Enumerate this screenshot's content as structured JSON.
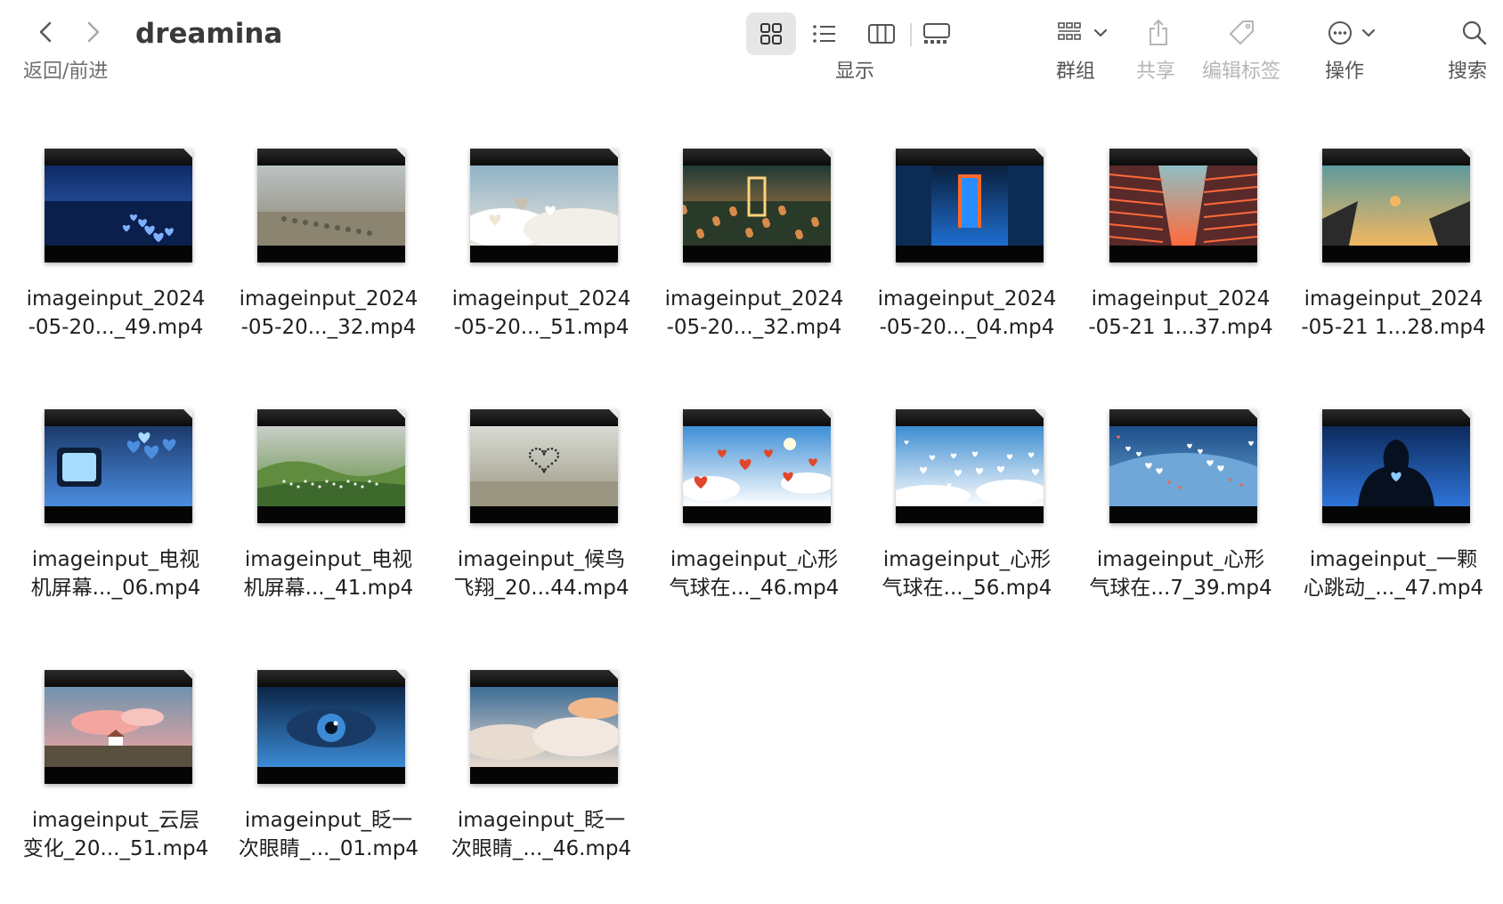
{
  "window": {
    "title": "dreamina"
  },
  "toolbar": {
    "nav_label": "返回/前进",
    "view_label": "显示",
    "group_label": "群组",
    "share_label": "共享",
    "tags_label": "编辑标签",
    "action_label": "操作",
    "search_label": "搜索"
  },
  "files": [
    {
      "line1": "imageinput_2024",
      "line2": "-05-20..._49.mp4",
      "scene": "blue-field-hearts",
      "colors": [
        "#0e2a66",
        "#3b6cc4",
        "#7fb0ff"
      ]
    },
    {
      "line1": "imageinput_2024",
      "line2": "-05-20..._32.mp4",
      "scene": "misty-meadow-path",
      "colors": [
        "#bcc3c4",
        "#8a8470",
        "#5e5a4a"
      ]
    },
    {
      "line1": "imageinput_2024",
      "line2": "-05-20..._51.mp4",
      "scene": "cloud-hearts",
      "colors": [
        "#8fb2c6",
        "#e9e5dc",
        "#c8c0ae"
      ]
    },
    {
      "line1": "imageinput_2024",
      "line2": "-05-20..._32.mp4",
      "scene": "glowing-door-flowers",
      "colors": [
        "#1e3a36",
        "#d98a4a",
        "#ffd27a"
      ]
    },
    {
      "line1": "imageinput_2024",
      "line2": "-05-20..._04.mp4",
      "scene": "city-portal",
      "colors": [
        "#0a1f3c",
        "#1f6ed0",
        "#ff6a2a"
      ]
    },
    {
      "line1": "imageinput_2024",
      "line2": "-05-21 1...37.mp4",
      "scene": "skyscraper-sky-lights",
      "colors": [
        "#8fbfc4",
        "#ff6a3a",
        "#5a2a2a"
      ]
    },
    {
      "line1": "imageinput_2024",
      "line2": "-05-21 1...28.mp4",
      "scene": "skyscraper-sky-sun",
      "colors": [
        "#5e9a9c",
        "#f2b860",
        "#2b2b2b"
      ]
    },
    {
      "line1": "imageinput_电视",
      "line2": "机屏幕..._06.mp4",
      "scene": "tv-heart-balloons",
      "colors": [
        "#1c3a6c",
        "#4c8de0",
        "#a8dcff"
      ]
    },
    {
      "line1": "imageinput_电视",
      "line2": "机屏幕..._41.mp4",
      "scene": "green-valley",
      "colors": [
        "#c9cfc9",
        "#5f8c3e",
        "#3d6a2c"
      ]
    },
    {
      "line1": "imageinput_候鸟",
      "line2": "飞翔_20...44.mp4",
      "scene": "bird-heart-sky",
      "colors": [
        "#d9dcd4",
        "#9a9682",
        "#2a2a2a"
      ]
    },
    {
      "line1": "imageinput_心形",
      "line2": "气球在..._46.mp4",
      "scene": "red-heart-balloons",
      "colors": [
        "#3e8fd6",
        "#ffffff",
        "#e0482c"
      ]
    },
    {
      "line1": "imageinput_心形",
      "line2": "气球在..._56.mp4",
      "scene": "white-heart-balloons",
      "colors": [
        "#3d8dd0",
        "#ffffff",
        "#e8eef5"
      ]
    },
    {
      "line1": "imageinput_心形",
      "line2": "气球在...7_39.mp4",
      "scene": "earth-hearts",
      "colors": [
        "#1d4f8a",
        "#6fa7d8",
        "#e86a58"
      ]
    },
    {
      "line1": "imageinput_一颗",
      "line2": "心跳动_..._47.mp4",
      "scene": "silhouette-heart",
      "colors": [
        "#0d2a5c",
        "#2e74d8",
        "#8ccaff"
      ]
    },
    {
      "line1": "imageinput_云层",
      "line2": "变化_20..._51.mp4",
      "scene": "pink-clouds-house",
      "colors": [
        "#6f93ae",
        "#f3a6a0",
        "#5a5040"
      ]
    },
    {
      "line1": "imageinput_眨一",
      "line2": "次眼睛_..._01.mp4",
      "scene": "blue-eye",
      "colors": [
        "#0c2547",
        "#3b8bd6",
        "#9fd3ff"
      ]
    },
    {
      "line1": "imageinput_眨一",
      "line2": "次眼睛_..._46.mp4",
      "scene": "sunset-clouds",
      "colors": [
        "#3d6d96",
        "#e8dbd0",
        "#f0b88c"
      ]
    }
  ]
}
